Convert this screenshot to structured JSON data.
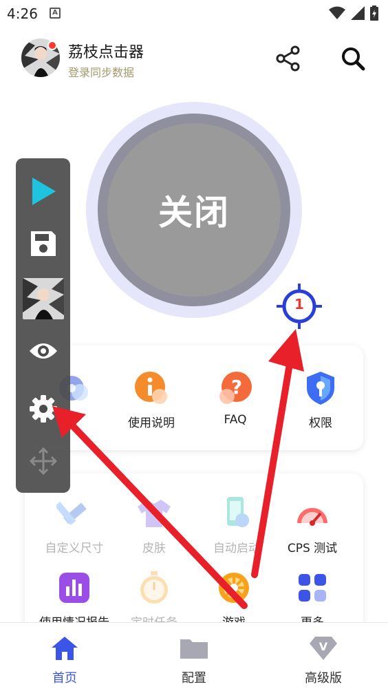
{
  "status_bar": {
    "time": "4:26",
    "notif_letter": "A"
  },
  "header": {
    "title": "荔枝点击器",
    "subtitle": "登录同步数据"
  },
  "power": {
    "label": "关闭"
  },
  "target": {
    "number": "1"
  },
  "card1": {
    "items": [
      {
        "label": "使用说明",
        "icon": "info-icon"
      },
      {
        "label": "FAQ",
        "icon": "question-icon"
      },
      {
        "label": "权限",
        "icon": "shield-key-icon"
      }
    ]
  },
  "card2": {
    "items": [
      {
        "label": "自定义尺寸",
        "icon": "ruler-pencil-icon"
      },
      {
        "label": "皮肤",
        "icon": "shirt-icon"
      },
      {
        "label": "自动启动",
        "icon": "phone-link-icon"
      },
      {
        "label": "CPS 测试",
        "icon": "speedometer-icon"
      },
      {
        "label": "使用情况报告",
        "icon": "bar-chart-icon"
      },
      {
        "label": "定时任务",
        "icon": "stopwatch-icon"
      },
      {
        "label": "游戏",
        "icon": "wheel-icon"
      },
      {
        "label": "更多",
        "icon": "grid-icon"
      }
    ]
  },
  "bottom_nav": {
    "items": [
      {
        "label": "首页",
        "icon": "home-icon"
      },
      {
        "label": "配置",
        "icon": "folder-icon"
      },
      {
        "label": "高级版",
        "icon": "vip-diamond-icon"
      }
    ]
  },
  "colors": {
    "accent": "#3b55e6",
    "arrow": "#e8202a",
    "panel": "#4b4b4b"
  }
}
